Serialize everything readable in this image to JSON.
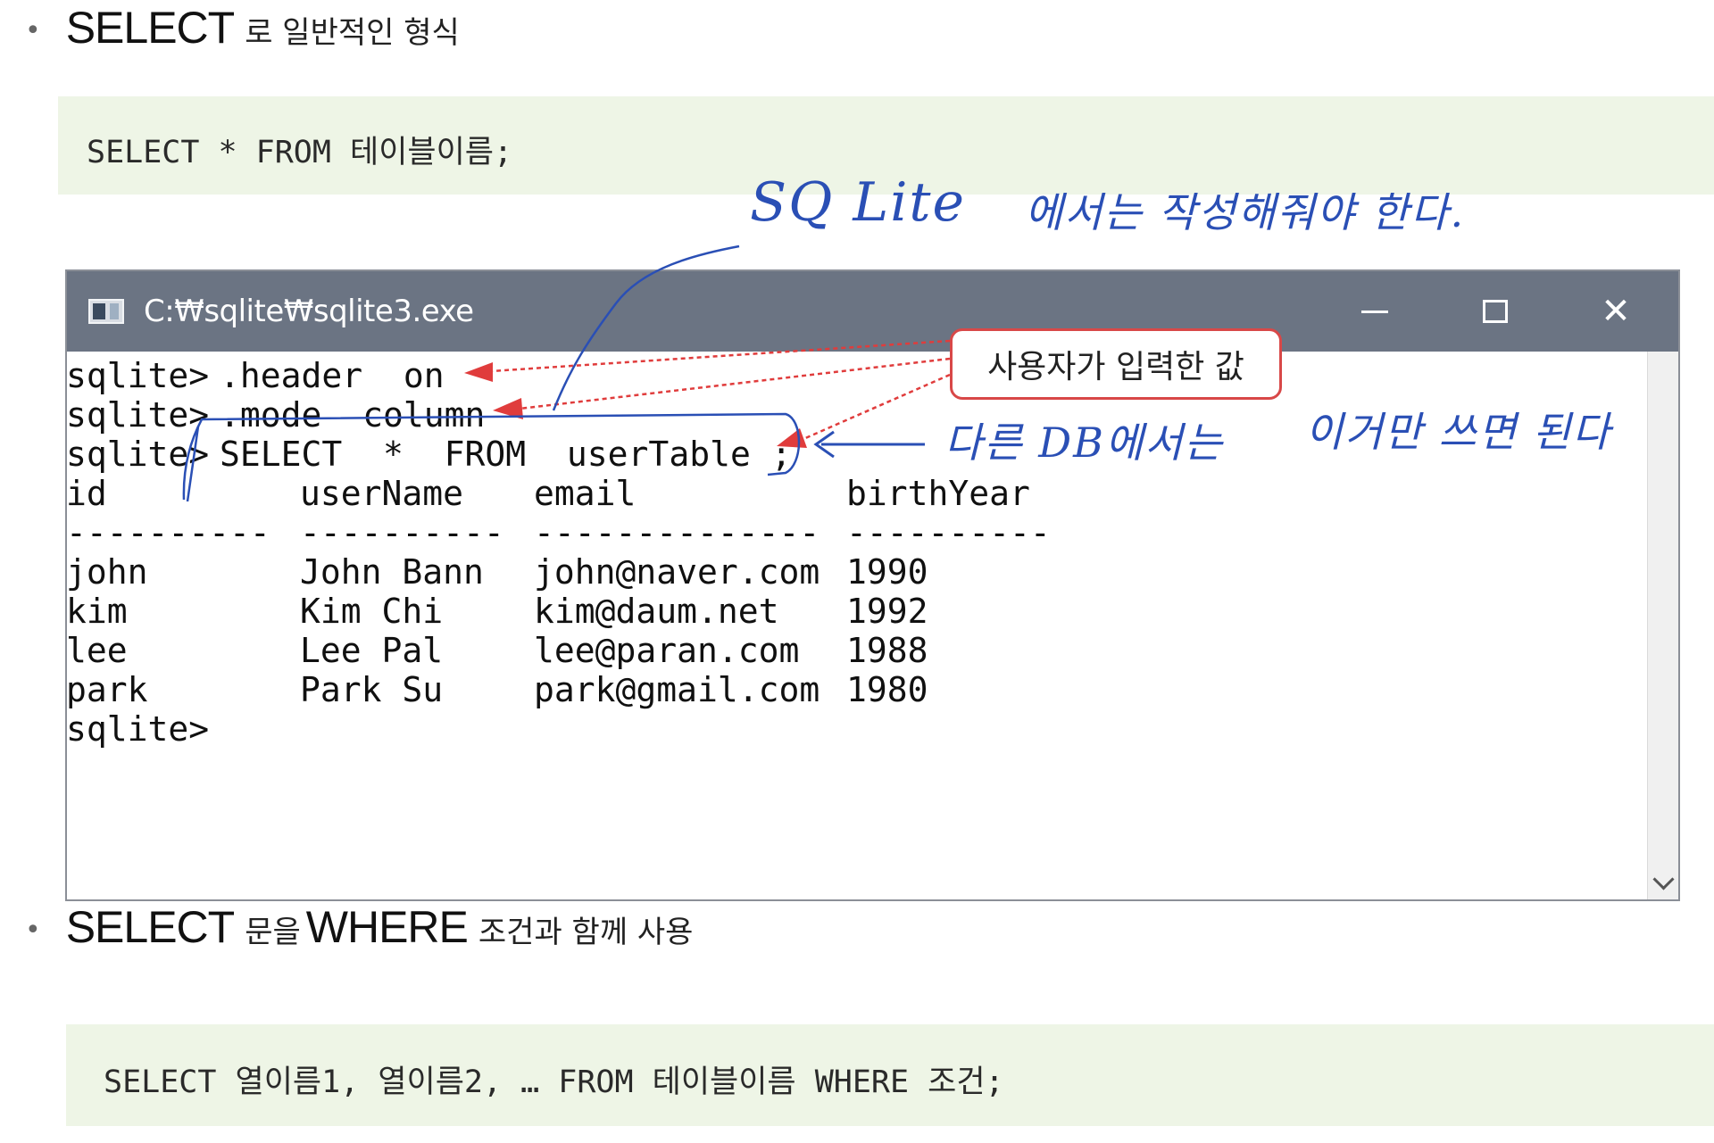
{
  "section1": {
    "bullet": "•",
    "keyword": "SELECT",
    "text": "로 일반적인 형식"
  },
  "code1": "SELECT * FROM 테이블이름;",
  "window": {
    "title": "C:₩sqlite₩sqlite3.exe",
    "minimize_icon": "minimize-icon",
    "maximize_icon": "maximize-icon",
    "close_icon": "close-icon",
    "close_glyph": "✕"
  },
  "console": {
    "lines": [
      {
        "prompt": "sqlite>",
        "command": ".header  on"
      },
      {
        "prompt": "sqlite>",
        "command": ".mode  column"
      },
      {
        "prompt": "sqlite>",
        "command": "SELECT  *  FROM  userTable ;"
      }
    ],
    "columns": [
      "id",
      "userName",
      "email",
      "birthYear"
    ],
    "separators": [
      "----------",
      "----------",
      "--------------",
      "----------"
    ],
    "rows": [
      [
        "john",
        "John Bann",
        "john@naver.com",
        "1990"
      ],
      [
        "kim",
        "Kim Chi",
        "kim@daum.net",
        "1992"
      ],
      [
        "lee",
        "Lee Pal",
        "lee@paran.com",
        "1988"
      ],
      [
        "park",
        "Park Su",
        "park@gmail.com",
        "1980"
      ]
    ],
    "final_prompt": "sqlite>"
  },
  "callout": "사용자가 입력한 값",
  "annotations": {
    "sqlite_label": "SQ Lite",
    "sqlite_note": "에서는  작성해줘야 한다.",
    "other_db_label": "다른 DB에서는",
    "other_db_note": "이거만 쓰면 된다"
  },
  "section2": {
    "bullet": "•",
    "keyword": "SELECT",
    "text_mid": "문을",
    "keyword2": "WHERE",
    "text": "조건과 함께 사용"
  },
  "code2": "SELECT 열이름1, 열이름2, … FROM 테이블이름 WHERE 조건;",
  "colors": {
    "code_bg": "#eef5e6",
    "title_bar": "#6b7483",
    "callout_border": "#d84848",
    "arrow_red": "#e03c3c",
    "handwriting_blue": "#2a4fb5"
  }
}
